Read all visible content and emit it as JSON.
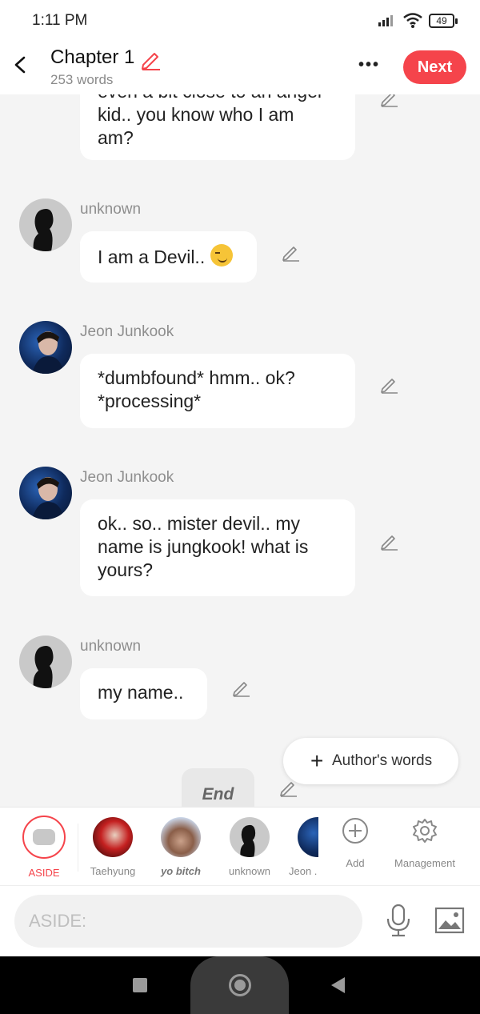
{
  "status_bar": {
    "time": "1:11 PM",
    "battery": "49"
  },
  "header": {
    "title": "Chapter 1",
    "word_count": "253 words",
    "next_label": "Next"
  },
  "messages": [
    {
      "speaker": "",
      "text": "even a bit close to an angel\nkid.. you know who I am\nam?",
      "partial": true
    },
    {
      "speaker": "unknown",
      "text": "I am a Devil.. ",
      "emoji": "smirking-face"
    },
    {
      "speaker": "Jeon Junkook",
      "text": "*dumbfound* hmm.. ok?\n*processing*"
    },
    {
      "speaker": "Jeon Junkook",
      "text": "ok.. so.. mister devil.. my\nname is jungkook! what is\nyours?"
    },
    {
      "speaker": "unknown",
      "text": "my name.."
    }
  ],
  "authors_words_label": "Author's words",
  "end_label": "End",
  "characters": [
    {
      "label": "ASIDE",
      "selected": true
    },
    {
      "label": "Taehyung"
    },
    {
      "label": "yo bitch"
    },
    {
      "label": "unknown"
    },
    {
      "label": "Jeon ."
    }
  ],
  "add_label": "Add",
  "management_label": "Management",
  "input": {
    "placeholder": "ASIDE:",
    "value": ""
  },
  "colors": {
    "accent": "#f5444b",
    "background": "#f4f4f4",
    "bubble": "#ffffff"
  }
}
